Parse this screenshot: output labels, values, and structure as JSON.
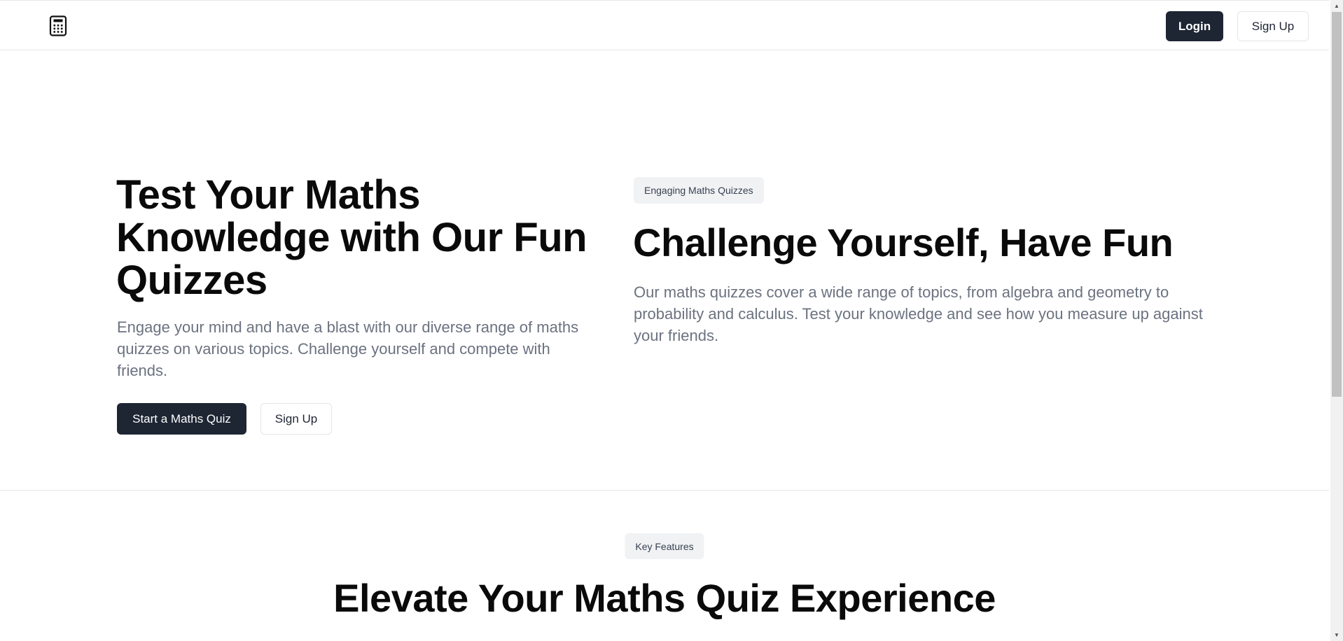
{
  "header": {
    "logo_icon": "calculator-icon",
    "login_label": "Login",
    "signup_label": "Sign Up"
  },
  "hero": {
    "title": "Test Your Maths Knowledge with Our Fun Quizzes",
    "subtitle": "Engage your mind and have a blast with our diverse range of maths quizzes on various topics. Challenge yourself and compete with friends.",
    "start_label": "Start a Maths Quiz",
    "signup_label": "Sign Up"
  },
  "challenge": {
    "badge": "Engaging Maths Quizzes",
    "title": "Challenge Yourself, Have Fun",
    "description": "Our maths quizzes cover a wide range of topics, from algebra and geometry to probability and calculus. Test your knowledge and see how you measure up against your friends."
  },
  "features": {
    "badge": "Key Features",
    "title": "Elevate Your Maths Quiz Experience"
  },
  "colors": {
    "primary_button": "#1e2533",
    "muted_text": "#6b7280",
    "badge_bg": "#f1f2f4",
    "border": "#e5e7eb"
  }
}
